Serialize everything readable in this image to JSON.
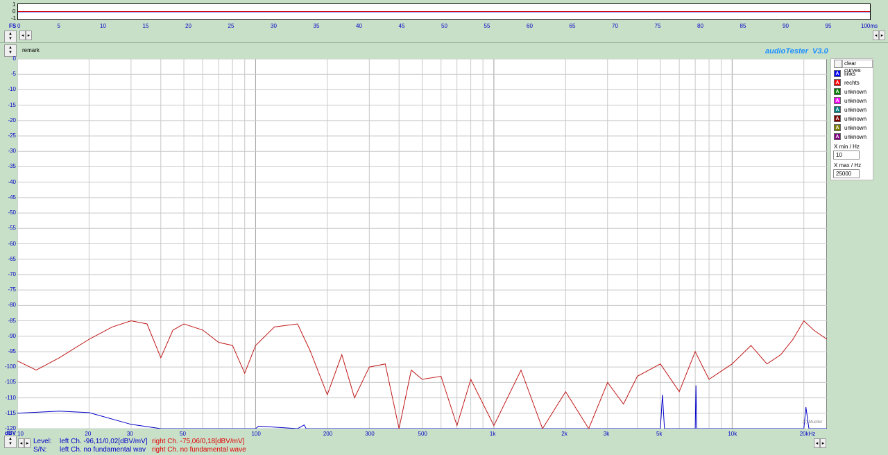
{
  "top_time": {
    "y_ticks": [
      "1",
      "0",
      "-1"
    ],
    "x_ticks": [
      "0",
      "5",
      "10",
      "15",
      "20",
      "25",
      "30",
      "35",
      "40",
      "45",
      "50",
      "55",
      "60",
      "65",
      "70",
      "75",
      "80",
      "85",
      "90",
      "95",
      "100ms"
    ],
    "fs_label": "FS"
  },
  "remark_label": "remark",
  "brand": "audioTester  V3.0",
  "spectrum": {
    "y_unit": "dBV",
    "y_ticks": [
      "0",
      "-5",
      "-10",
      "-15",
      "-20",
      "-25",
      "-30",
      "-35",
      "-40",
      "-45",
      "-50",
      "-55",
      "-60",
      "-65",
      "-70",
      "-75",
      "-80",
      "-85",
      "-90",
      "-95",
      "-100",
      "-105",
      "-110",
      "-115",
      "-120"
    ],
    "x_ticks": [
      "10",
      "20",
      "30",
      "50",
      "100",
      "200",
      "300",
      "500",
      "1k",
      "2k",
      "3k",
      "5k",
      "10k",
      "20kHz"
    ],
    "watermark": "(c) Mueller"
  },
  "side_panel": {
    "clear_label": "clear curves",
    "legend": [
      {
        "letter": "A",
        "label": "links",
        "color": "#0000ff"
      },
      {
        "letter": "A",
        "label": "rechts",
        "color": "#ff0000"
      },
      {
        "letter": "A",
        "label": "unknown",
        "color": "#008000"
      },
      {
        "letter": "A",
        "label": "unknown",
        "color": "#ff00ff"
      },
      {
        "letter": "A",
        "label": "unknown",
        "color": "#008080"
      },
      {
        "letter": "A",
        "label": "unknown",
        "color": "#800000"
      },
      {
        "letter": "A",
        "label": "unknown",
        "color": "#808000"
      },
      {
        "letter": "A",
        "label": "unknown",
        "color": "#800080"
      }
    ],
    "xmin_label": "X min / Hz",
    "xmin_value": "10",
    "xmax_label": "X max / Hz",
    "xmax_value": "25000"
  },
  "status": {
    "level_label": "Level:",
    "level_left": "left Ch.  -96,11/0,02[dBV/mV]",
    "level_right": "right Ch.  -75,06/0,18[dBV/mV]",
    "sn_label": "S/N:",
    "sn_left": "left Ch.  no fundamental wav",
    "sn_right": "right Ch.  no fundamental wave"
  },
  "colors": {
    "left": "#0000c8",
    "right": "#c01818",
    "brand": "#1e90ff"
  },
  "chart_data": {
    "type": "line",
    "xlabel": "",
    "ylabel": "dBV",
    "xscale": "log",
    "xlim": [
      10,
      25000
    ],
    "ylim": [
      -120,
      0
    ],
    "grid": true,
    "series": [
      {
        "name": "links",
        "x": [
          10,
          15,
          20,
          30,
          40,
          50,
          80,
          100,
          103,
          150,
          160,
          163,
          200,
          1000,
          5000,
          5100,
          5200,
          7000,
          7050,
          7100,
          10000,
          20000,
          20400,
          21000,
          25000
        ],
        "y": [
          -115,
          -114.3,
          -114.8,
          -118.6,
          -120,
          -120,
          -120,
          -120,
          -119.2,
          -120,
          -118.8,
          -120,
          -120,
          -120,
          -120,
          -109,
          -120,
          -120,
          -106,
          -120,
          -120,
          -120,
          -113,
          -120,
          -120
        ]
      },
      {
        "name": "rechts",
        "x": [
          10,
          12,
          15,
          20,
          25,
          30,
          35,
          40,
          45,
          50,
          60,
          70,
          80,
          90,
          100,
          120,
          150,
          170,
          200,
          230,
          260,
          300,
          350,
          400,
          450,
          500,
          600,
          700,
          800,
          1000,
          1300,
          1600,
          2000,
          2500,
          3000,
          3500,
          4000,
          5000,
          6000,
          7000,
          8000,
          10000,
          12000,
          14000,
          16000,
          18000,
          20000,
          22000,
          25000
        ],
        "y": [
          -98,
          -101,
          -97,
          -91,
          -87,
          -85,
          -86,
          -97,
          -88,
          -86,
          -88,
          -92,
          -93,
          -102,
          -93,
          -87,
          -86,
          -95,
          -109,
          -96,
          -110,
          -100,
          -99,
          -120,
          -101,
          -104,
          -103,
          -119,
          -104,
          -119,
          -101,
          -120,
          -108,
          -120,
          -105,
          -112,
          -103,
          -99,
          -108,
          -95,
          -104,
          -99,
          -93,
          -99,
          -96,
          -91,
          -85,
          -88,
          -91
        ]
      }
    ]
  }
}
